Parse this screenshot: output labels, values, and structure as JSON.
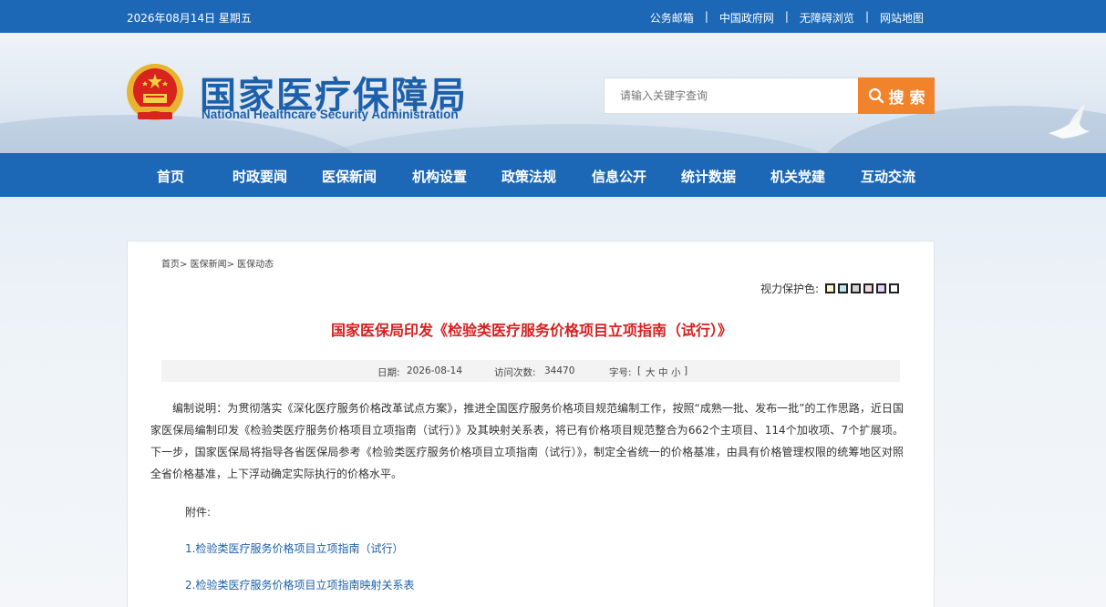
{
  "topbar": {
    "date": "2026年08月14日 星期五",
    "links": [
      "公务邮箱",
      "中国政府网",
      "无障碍浏览",
      "网站地图"
    ],
    "separator": "|"
  },
  "header": {
    "logo_cn": "国家医疗保障局",
    "logo_en": "National Healthcare Security Administration",
    "search_placeholder": "请输入关键字查询",
    "search_button": "搜 索",
    "search_icon": "magnifier-icon"
  },
  "nav": {
    "items": [
      "首页",
      "时政要闻",
      "医保新闻",
      "机构设置",
      "政策法规",
      "信息公开",
      "统计数据",
      "机关党建",
      "互动交流"
    ]
  },
  "breadcrumb": {
    "items": [
      "首页",
      "医保新闻",
      "医保动态"
    ],
    "separator": ">"
  },
  "eyecare": {
    "label": "视力保护色:",
    "colors": [
      "#fbf7c7",
      "#bfe3f0",
      "#d3d3d3",
      "#f6d6dd",
      "#e4d2f5",
      "#ffffff"
    ]
  },
  "article": {
    "title": "国家医保局印发《检验类医疗服务价格项目立项指南（试行）》",
    "date_label": "日期:",
    "date": "2026-08-14",
    "visits_label": "访问次数:",
    "visits": "34470",
    "fontsize_label": "字号:",
    "fontsize_open": "[",
    "fontsize_options": [
      "大",
      "中",
      "小"
    ],
    "fontsize_close": "]",
    "body": "编制说明：为贯彻落实《深化医疗服务价格改革试点方案》，推进全国医疗服务价格项目规范编制工作，按照“成熟一批、发布一批”的工作思路，近日国家医保局编制印发《检验类医疗服务价格项目立项指南（试行）》及其映射关系表，将已有价格项目规范整合为662个主项目、114个加收项、7个扩展项。下一步，国家医保局将指导各省医保局参考《检验类医疗服务价格项目立项指南（试行）》，制定全省统一的价格基准，由具有价格管理权限的统筹地区对照全省价格基准，上下浮动确定实际执行的价格水平。",
    "attachments_label": "附件:",
    "attachments": [
      "1.检验类医疗服务价格项目立项指南（试行）",
      "2.检验类医疗服务价格项目立项指南映射关系表"
    ]
  },
  "colors": {
    "primary_blue": "#1c68b7",
    "search_orange": "#f1832b",
    "title_red": "#d61f1f",
    "link_blue": "#1c5faa"
  }
}
